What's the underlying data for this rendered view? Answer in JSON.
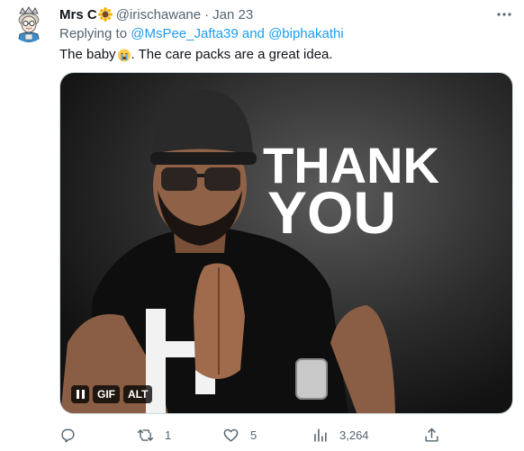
{
  "tweet": {
    "author_name": "Mrs C",
    "author_name_emoji": "sunflower-emoji",
    "handle": "@irischawane",
    "separator": "·",
    "date": "Jan 23",
    "more_icon": "more-horizontal-icon",
    "replying_prefix": "Replying to",
    "replying_to": [
      "@MsPee_Jafta39",
      "@biphakathi"
    ],
    "replying_and": "and",
    "text_before_emoji": "The baby",
    "text_emoji": "crying-face-emoji",
    "text_after_emoji": ". The care packs are a great idea."
  },
  "media": {
    "kind": "GIF",
    "overlay_text_line1": "THANK",
    "overlay_text_line2": "YOU",
    "pause_icon": "pause-icon",
    "gif_label": "GIF",
    "alt_label": "ALT"
  },
  "actions": {
    "reply": {
      "icon": "reply-icon",
      "count": ""
    },
    "retweet": {
      "icon": "retweet-icon",
      "count": "1"
    },
    "like": {
      "icon": "heart-icon",
      "count": "5"
    },
    "views": {
      "icon": "analytics-icon",
      "count": "3,264"
    },
    "share": {
      "icon": "share-icon"
    }
  },
  "colors": {
    "link": "#1d9bf0",
    "secondary_text": "#536471",
    "primary_text": "#0f1419"
  }
}
